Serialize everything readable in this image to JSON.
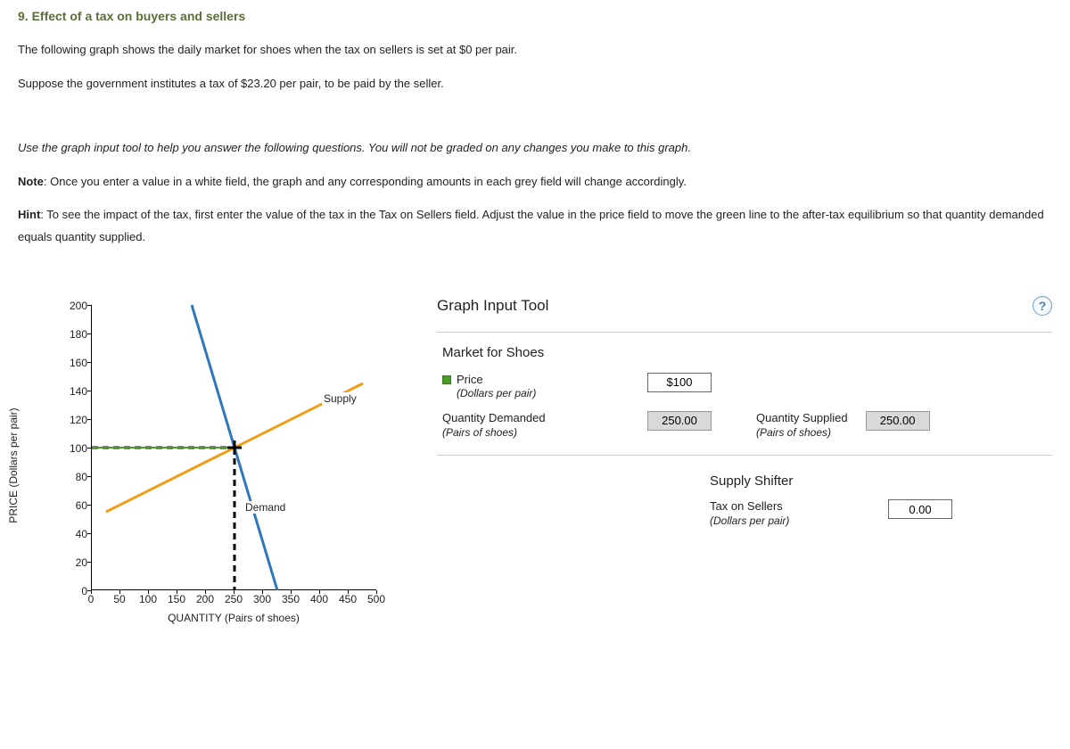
{
  "title": "9. Effect of a tax on buyers and sellers",
  "intro": {
    "p1": "The following graph shows the daily market for shoes when the tax on sellers is set at $0 per pair.",
    "p2": "Suppose the government institutes a tax of $23.20 per pair, to be paid by the seller."
  },
  "instructions": {
    "italic": "Use the graph input tool to help you answer the following questions. You will not be graded on any changes you make to this graph.",
    "note_label": "Note",
    "note": ": Once you enter a value in a white field, the graph and any corresponding amounts in each grey field will change accordingly.",
    "hint_label": "Hint",
    "hint": ": To see the impact of the tax, first enter the value of the tax in the Tax on Sellers field. Adjust the value in the price field to move the green line to the after-tax equilibrium so that quantity demanded equals quantity supplied."
  },
  "chart": {
    "ylabel": "PRICE (Dollars per pair)",
    "xlabel": "QUANTITY (Pairs of shoes)",
    "supply_label": "Supply",
    "demand_label": "Demand"
  },
  "chart_data": {
    "type": "line",
    "xlabel": "QUANTITY (Pairs of shoes)",
    "ylabel": "PRICE (Dollars per pair)",
    "xlim": [
      0,
      500
    ],
    "ylim": [
      0,
      200
    ],
    "xticks": [
      0,
      50,
      100,
      150,
      200,
      250,
      300,
      350,
      400,
      450,
      500
    ],
    "yticks": [
      0,
      20,
      40,
      60,
      80,
      100,
      120,
      140,
      160,
      180,
      200
    ],
    "series": [
      {
        "name": "Demand",
        "color": "#2e77bd",
        "x": [
          175,
          325
        ],
        "y": [
          200,
          0
        ]
      },
      {
        "name": "Supply",
        "color": "#f39c12",
        "x": [
          25,
          475
        ],
        "y": [
          55,
          145
        ]
      },
      {
        "name": "Price line",
        "color": "#4c9a2a",
        "x": [
          0,
          250
        ],
        "y": [
          100,
          100
        ],
        "style": "solid"
      },
      {
        "name": "Dashed horizontal",
        "color": "#000",
        "x": [
          0,
          250
        ],
        "y": [
          100,
          100
        ],
        "style": "dashed"
      },
      {
        "name": "Dashed vertical",
        "color": "#000",
        "x": [
          250,
          250
        ],
        "y": [
          0,
          100
        ],
        "style": "dashed"
      }
    ],
    "equilibrium": {
      "quantity": 250,
      "price": 100
    }
  },
  "panel": {
    "title": "Graph Input Tool",
    "market_title": "Market for Shoes",
    "price_label": "Price",
    "price_sub": "(Dollars per pair)",
    "price_value": "$100",
    "qd_label": "Quantity Demanded",
    "qd_sub": "(Pairs of shoes)",
    "qd_value": "250.00",
    "qs_label": "Quantity Supplied",
    "qs_sub": "(Pairs of shoes)",
    "qs_value": "250.00",
    "supply_shifter_title": "Supply Shifter",
    "tax_label": "Tax on Sellers",
    "tax_sub": "(Dollars per pair)",
    "tax_value": "0.00"
  }
}
